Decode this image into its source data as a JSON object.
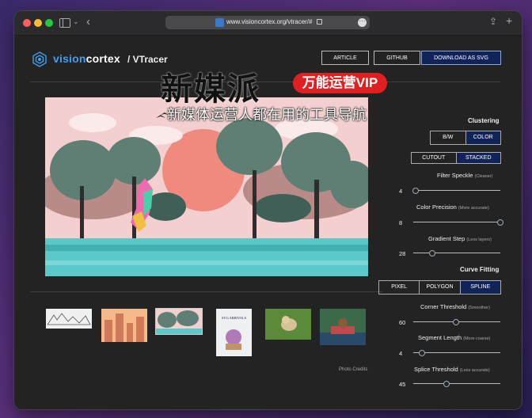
{
  "browser": {
    "url": "www.visioncortex.org/vtracer/#"
  },
  "header": {
    "brand_vision": "vision",
    "brand_cortex": "cortex",
    "title": "/ VTracer",
    "buttons": {
      "article": "ARTICLE",
      "github": "GITHUB",
      "download": "DOWNLOAD AS SVG"
    }
  },
  "watermark": {
    "big": "新媒派",
    "badge": "万能运营VIP",
    "sub": "新媒体运营人都在用的工具导航"
  },
  "gallery": {
    "photo_credits": "Photo Credits",
    "poster_title": "SVG ARRIVALS"
  },
  "controls": {
    "clustering": {
      "heading": "Clustering",
      "color_mode": {
        "options": [
          "B/W",
          "COLOR"
        ],
        "selected": "COLOR"
      },
      "hierarchy": {
        "options": [
          "CUTOUT",
          "STACKED"
        ],
        "selected": "STACKED"
      },
      "filter_speckle": {
        "label": "Filter Speckle",
        "hint": "(Cleaner)",
        "value": "4",
        "fraction": 0.03
      },
      "color_precision": {
        "label": "Color Precision",
        "hint": "(More accurate)",
        "value": "8",
        "fraction": 1.0
      },
      "gradient_step": {
        "label": "Gradient Step",
        "hint": "(Less layers)",
        "value": "28",
        "fraction": 0.22
      }
    },
    "curve_fitting": {
      "heading": "Curve Fitting",
      "mode": {
        "options": [
          "PIXEL",
          "POLYGON",
          "SPLINE"
        ],
        "selected": "SPLINE"
      },
      "corner_threshold": {
        "label": "Corner Threshold",
        "hint": "(Smoother)",
        "value": "60",
        "fraction": 0.49
      },
      "segment_length": {
        "label": "Segment Length",
        "hint": "(More coarse)",
        "value": "4",
        "fraction": 0.1
      },
      "splice_threshold": {
        "label": "Splice Threshold",
        "hint": "(Less accurate)",
        "value": "45",
        "fraction": 0.38
      }
    }
  },
  "colors": {
    "accent_blue": "#11245a",
    "brand_blue": "#3fa0f0",
    "watermark_red": "#e02020"
  }
}
